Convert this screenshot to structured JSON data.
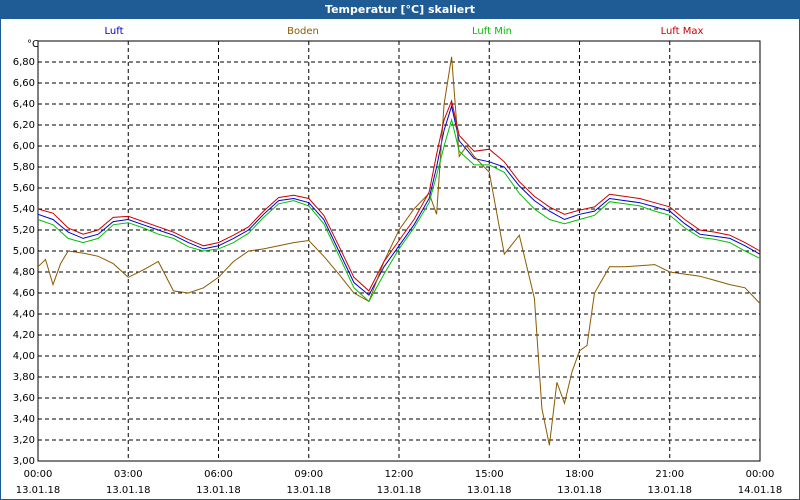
{
  "window": {
    "title": "Temperatur [°C] skaliert"
  },
  "colors": {
    "title_bar": "#1f5c96",
    "luft": "#0000cc",
    "boden": "#8b5a00",
    "luft_min": "#00c000",
    "luft_max": "#cc0000",
    "grid": "#000000"
  },
  "chart_data": {
    "type": "line",
    "title": "Temperatur [°C] skaliert",
    "ylabel": "°C",
    "xlabel": "",
    "ylim": [
      3.0,
      7.0
    ],
    "xlim": [
      0,
      24
    ],
    "grid": true,
    "legend_position": "top",
    "y_ticks": [
      "3,00",
      "3,20",
      "3,40",
      "3,60",
      "3,80",
      "4,00",
      "4,20",
      "4,40",
      "4,60",
      "4,80",
      "5,00",
      "5,20",
      "5,40",
      "5,60",
      "5,80",
      "6,00",
      "6,20",
      "6,40",
      "6,60",
      "6,80"
    ],
    "x_ticks": [
      {
        "time": "00:00",
        "date": "13.01.18"
      },
      {
        "time": "03:00",
        "date": "13.01.18"
      },
      {
        "time": "06:00",
        "date": "13.01.18"
      },
      {
        "time": "09:00",
        "date": "13.01.18"
      },
      {
        "time": "12:00",
        "date": "13.01.18"
      },
      {
        "time": "15:00",
        "date": "13.01.18"
      },
      {
        "time": "18:00",
        "date": "13.01.18"
      },
      {
        "time": "21:00",
        "date": "13.01.18"
      },
      {
        "time": "00:00",
        "date": "14.01.18"
      }
    ],
    "series": [
      {
        "name": "Luft",
        "color": "#0000cc",
        "x": [
          0,
          0.5,
          1,
          1.5,
          2,
          2.5,
          3,
          3.5,
          4,
          4.5,
          5,
          5.5,
          6,
          6.5,
          7,
          7.5,
          8,
          8.5,
          9,
          9.5,
          10,
          10.5,
          11,
          11.5,
          12,
          12.5,
          13,
          13.25,
          13.5,
          13.75,
          14,
          14.5,
          15,
          15.5,
          16,
          16.5,
          17,
          17.5,
          18,
          18.5,
          19,
          19.5,
          20,
          20.5,
          21,
          21.5,
          22,
          22.5,
          23,
          23.5,
          24
        ],
        "y": [
          5.35,
          5.3,
          5.18,
          5.12,
          5.16,
          5.28,
          5.3,
          5.25,
          5.2,
          5.15,
          5.08,
          5.02,
          5.05,
          5.12,
          5.2,
          5.35,
          5.48,
          5.5,
          5.46,
          5.3,
          5.0,
          4.7,
          4.58,
          4.85,
          5.05,
          5.25,
          5.5,
          5.8,
          6.15,
          6.38,
          6.05,
          5.88,
          5.85,
          5.8,
          5.62,
          5.48,
          5.38,
          5.3,
          5.35,
          5.38,
          5.5,
          5.48,
          5.46,
          5.42,
          5.38,
          5.26,
          5.16,
          5.14,
          5.12,
          5.05,
          4.97
        ]
      },
      {
        "name": "Boden",
        "color": "#8b5a00",
        "x": [
          0,
          0.25,
          0.5,
          0.75,
          1,
          1.5,
          2,
          2.5,
          3,
          3.5,
          4,
          4.5,
          5,
          5.5,
          6,
          6.5,
          7,
          7.5,
          8,
          8.5,
          9,
          9.5,
          10,
          10.5,
          11,
          11.5,
          12,
          12.5,
          13,
          13.25,
          13.5,
          13.75,
          14,
          14.25,
          14.5,
          15,
          15.5,
          16,
          16.5,
          16.75,
          17,
          17.25,
          17.5,
          17.75,
          18,
          18.25,
          18.5,
          19,
          19.5,
          20,
          20.5,
          21,
          21.5,
          22,
          22.5,
          23,
          23.5,
          24
        ],
        "y": [
          4.85,
          4.92,
          4.68,
          4.88,
          5.0,
          4.98,
          4.95,
          4.88,
          4.75,
          4.82,
          4.9,
          4.62,
          4.6,
          4.65,
          4.75,
          4.9,
          5.0,
          5.02,
          5.05,
          5.08,
          5.1,
          4.95,
          4.78,
          4.6,
          4.52,
          4.9,
          5.2,
          5.4,
          5.55,
          5.35,
          6.4,
          6.85,
          5.9,
          6.0,
          5.9,
          5.75,
          4.97,
          5.15,
          4.55,
          3.5,
          3.15,
          3.75,
          3.55,
          3.85,
          4.05,
          4.1,
          4.6,
          4.85,
          4.85,
          4.86,
          4.87,
          4.8,
          4.78,
          4.76,
          4.72,
          4.68,
          4.65,
          4.5
        ]
      },
      {
        "name": "Luft Min",
        "color": "#00c000",
        "x": [
          0,
          0.5,
          1,
          1.5,
          2,
          2.5,
          3,
          3.5,
          4,
          4.5,
          5,
          5.5,
          6,
          6.5,
          7,
          7.5,
          8,
          8.5,
          9,
          9.5,
          10,
          10.5,
          11,
          11.5,
          12,
          12.5,
          13,
          13.25,
          13.5,
          13.75,
          14,
          14.5,
          15,
          15.5,
          16,
          16.5,
          17,
          17.5,
          18,
          18.5,
          19,
          19.5,
          20,
          20.5,
          21,
          21.5,
          22,
          22.5,
          23,
          23.5,
          24
        ],
        "y": [
          5.3,
          5.25,
          5.12,
          5.08,
          5.12,
          5.25,
          5.27,
          5.22,
          5.16,
          5.12,
          5.04,
          5.0,
          5.02,
          5.08,
          5.17,
          5.32,
          5.45,
          5.48,
          5.43,
          5.26,
          4.96,
          4.65,
          4.52,
          4.78,
          5.02,
          5.22,
          5.46,
          5.72,
          6.0,
          6.25,
          5.95,
          5.82,
          5.82,
          5.75,
          5.55,
          5.4,
          5.3,
          5.26,
          5.3,
          5.34,
          5.47,
          5.45,
          5.43,
          5.38,
          5.34,
          5.22,
          5.13,
          5.11,
          5.08,
          5.0,
          4.93
        ]
      },
      {
        "name": "Luft Max",
        "color": "#cc0000",
        "x": [
          0,
          0.5,
          1,
          1.5,
          2,
          2.5,
          3,
          3.5,
          4,
          4.5,
          5,
          5.5,
          6,
          6.5,
          7,
          7.5,
          8,
          8.5,
          9,
          9.5,
          10,
          10.5,
          11,
          11.5,
          12,
          12.5,
          13,
          13.25,
          13.5,
          13.75,
          14,
          14.5,
          15,
          15.5,
          16,
          16.5,
          17,
          17.5,
          18,
          18.5,
          19,
          19.5,
          20,
          20.5,
          21,
          21.5,
          22,
          22.5,
          23,
          23.5,
          24
        ],
        "y": [
          5.4,
          5.36,
          5.22,
          5.16,
          5.2,
          5.32,
          5.33,
          5.28,
          5.23,
          5.18,
          5.11,
          5.05,
          5.08,
          5.15,
          5.23,
          5.38,
          5.51,
          5.53,
          5.5,
          5.34,
          5.05,
          4.75,
          4.62,
          4.9,
          5.1,
          5.3,
          5.56,
          5.92,
          6.25,
          6.43,
          6.1,
          5.95,
          5.97,
          5.85,
          5.66,
          5.52,
          5.42,
          5.35,
          5.39,
          5.42,
          5.54,
          5.52,
          5.5,
          5.46,
          5.42,
          5.3,
          5.2,
          5.18,
          5.15,
          5.08,
          5.0
        ]
      }
    ]
  }
}
